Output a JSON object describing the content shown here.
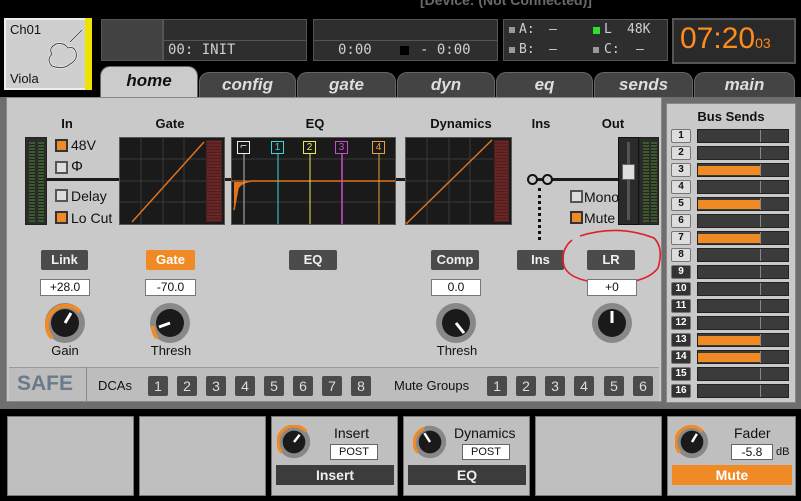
{
  "device_title": "[Device: (Not Connected)]",
  "channel": {
    "name": "Ch01",
    "label": "Viola"
  },
  "scene": {
    "line1": "",
    "line2": "00: INIT"
  },
  "transport": {
    "time_elapsed": "0:00",
    "time_remaining": "- 0:00"
  },
  "sync": {
    "a_label": "A:",
    "a_value": "–",
    "b_label": "B:",
    "b_value": "–",
    "l_label": "L",
    "l_value": "48K",
    "c_label": "C:",
    "c_value": "–"
  },
  "clock": {
    "time": "07:20",
    "seconds": "03"
  },
  "tabs": [
    "home",
    "config",
    "gate",
    "dyn",
    "eq",
    "sends",
    "main"
  ],
  "sections": {
    "in": "In",
    "gate": "Gate",
    "eq": "EQ",
    "dynamics": "Dynamics",
    "ins": "Ins",
    "out": "Out"
  },
  "input": {
    "phantom": "48V",
    "phase": "Φ",
    "delay": "Delay",
    "locut": "Lo Cut"
  },
  "eq_bands": [
    "⌐",
    "1",
    "2",
    "3",
    "4"
  ],
  "output": {
    "mono": "Mono",
    "mute": "Mute"
  },
  "buttons": {
    "link": "Link",
    "gate": "Gate",
    "eq": "EQ",
    "comp": "Comp",
    "ins": "Ins",
    "lr": "LR"
  },
  "values": {
    "gain": "+28.0",
    "gate_thresh": "-70.0",
    "comp_thresh": "0.0",
    "pan": "+0"
  },
  "knob_labels": {
    "gain": "Gain",
    "gate_thresh": "Thresh",
    "comp_thresh": "Thresh"
  },
  "safe": "SAFE",
  "dcas": {
    "label": "DCAs",
    "items": [
      "1",
      "2",
      "3",
      "4",
      "5",
      "6",
      "7",
      "8"
    ]
  },
  "mute_groups": {
    "label": "Mute Groups",
    "items": [
      "1",
      "2",
      "3",
      "4",
      "5",
      "6"
    ]
  },
  "bus_sends": {
    "title": "Bus Sends",
    "rows": [
      {
        "num": "1",
        "level": 0
      },
      {
        "num": "2",
        "level": 0
      },
      {
        "num": "3",
        "level": 0.7
      },
      {
        "num": "4",
        "level": 0
      },
      {
        "num": "5",
        "level": 0.7
      },
      {
        "num": "6",
        "level": 0
      },
      {
        "num": "7",
        "level": 0.7
      },
      {
        "num": "8",
        "level": 0
      },
      {
        "num": "9",
        "level": 0
      },
      {
        "num": "10",
        "level": 0
      },
      {
        "num": "11",
        "level": 0
      },
      {
        "num": "12",
        "level": 0
      },
      {
        "num": "13",
        "level": 0.7
      },
      {
        "num": "14",
        "level": 0.7
      },
      {
        "num": "15",
        "level": 0
      },
      {
        "num": "16",
        "level": 0
      }
    ]
  },
  "footer": {
    "insert": {
      "title": "Insert",
      "value": "POST",
      "button": "Insert"
    },
    "dynamics": {
      "title": "Dynamics",
      "value": "POST",
      "button": "EQ"
    },
    "fader": {
      "title": "Fader",
      "value": "-5.8",
      "unit": "dB",
      "button": "Mute"
    }
  },
  "colors": {
    "accent": "#f08a24",
    "clock": "#ff8a1e",
    "selected_channel": "#f0e200",
    "annotation": "#e0202a"
  }
}
